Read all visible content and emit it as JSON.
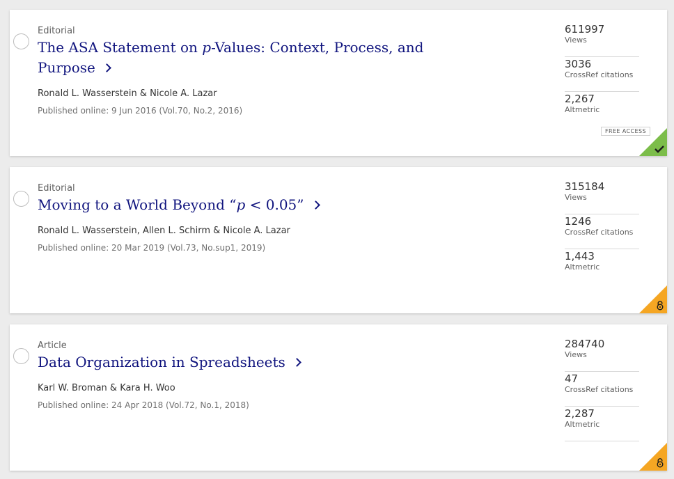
{
  "results": [
    {
      "type": "Editorial",
      "title_parts": [
        "The ASA Statement on ",
        "p",
        "-Values: Context, Process, and"
      ],
      "title_line2": "Purpose",
      "authors": [
        "Ronald L. Wasserstein",
        " & ",
        "Nicole A. Lazar"
      ],
      "published": "Published online: 9 Jun 2016 (Vol.70, No.2, 2016)",
      "views": "611997",
      "views_label": "Views",
      "crossref": "3036",
      "crossref_label": "CrossRef citations",
      "altmetric": "2,267",
      "altmetric_label": "Altmetric",
      "access_badge": "FREE ACCESS",
      "corner_icon": "checkmark-icon",
      "corner_color": "#7cbd4a"
    },
    {
      "type": "Editorial",
      "title_parts": [
        "Moving to a World Beyond “",
        "p",
        " < 0.05”"
      ],
      "authors": [
        "Ronald L. Wasserstein",
        ", ",
        "Allen L. Schirm",
        " & ",
        "Nicole A. Lazar"
      ],
      "published": "Published online: 20 Mar 2019 (Vol.73, No.sup1, 2019)",
      "views": "315184",
      "views_label": "Views",
      "crossref": "1246",
      "crossref_label": "CrossRef citations",
      "altmetric": "1,443",
      "altmetric_label": "Altmetric",
      "corner_icon": "open-access-icon",
      "corner_color": "#f5a623"
    },
    {
      "type": "Article",
      "title_parts": [
        "Data Organization in Spreadsheets"
      ],
      "authors": [
        "Karl W. Broman",
        " & ",
        "Kara H. Woo"
      ],
      "published": "Published online: 24 Apr 2018 (Vol.72, No.1, 2018)",
      "views": "284740",
      "views_label": "Views",
      "crossref": "47",
      "crossref_label": "CrossRef citations",
      "altmetric": "2,287",
      "altmetric_label": "Altmetric",
      "corner_icon": "open-access-icon",
      "corner_color": "#f5a623"
    }
  ]
}
